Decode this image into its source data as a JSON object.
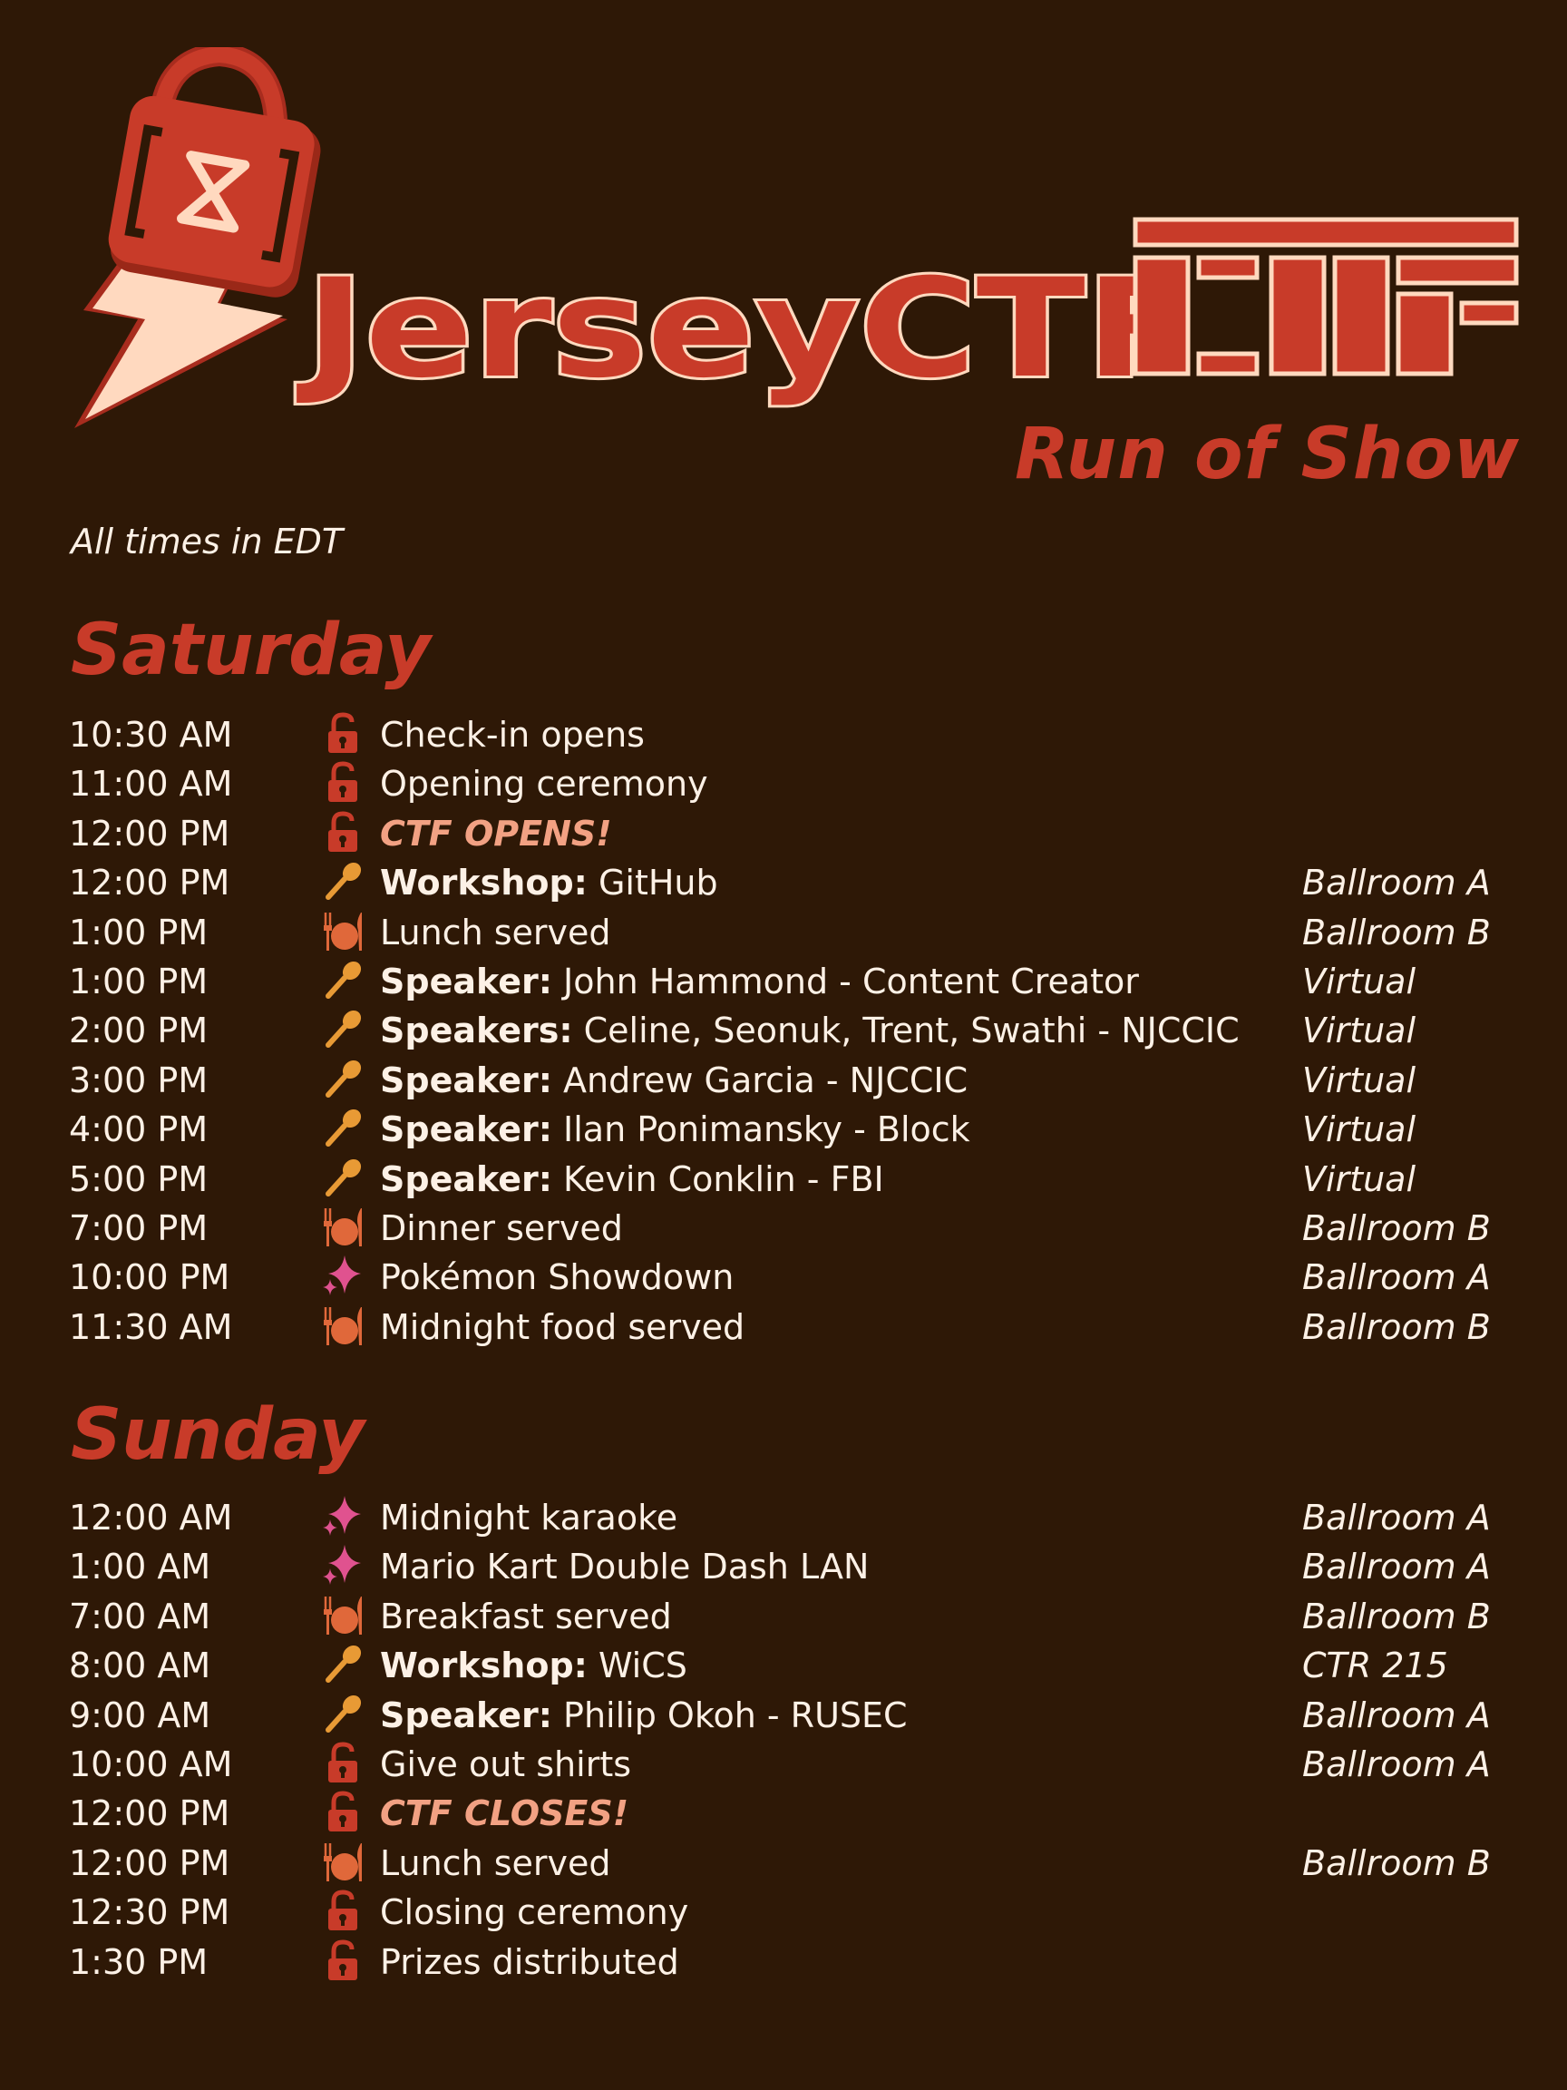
{
  "header": {
    "logo_text": "JerseyCTF",
    "subtitle": "Run of Show",
    "timezone_note": "All times in EDT"
  },
  "colors": {
    "background": "#2e1806",
    "accent_red": "#c83b29",
    "cream": "#ffd9bf",
    "highlight": "#f2a183",
    "mic_orange": "#e89a35",
    "food_orange": "#e0683a",
    "sparkle_pink": "#e0528f"
  },
  "days": [
    {
      "name": "Saturday",
      "events": [
        {
          "time": "10:30 AM",
          "icon": "lock-icon",
          "prefix": "",
          "text": "Check-in opens",
          "location": ""
        },
        {
          "time": "11:00 AM",
          "icon": "lock-icon",
          "prefix": "",
          "text": "Opening ceremony",
          "location": ""
        },
        {
          "time": "12:00 PM",
          "icon": "lock-icon",
          "prefix": "",
          "text": "CTF OPENS!",
          "location": "",
          "highlight": true
        },
        {
          "time": "12:00 PM",
          "icon": "microphone-icon",
          "prefix": "Workshop:",
          "text": " GitHub",
          "location": "Ballroom A"
        },
        {
          "time": "1:00 PM",
          "icon": "meal-icon",
          "prefix": "",
          "text": "Lunch served",
          "location": "Ballroom B"
        },
        {
          "time": "1:00 PM",
          "icon": "microphone-icon",
          "prefix": "Speaker:",
          "text": " John Hammond - Content Creator",
          "location": "Virtual"
        },
        {
          "time": "2:00 PM",
          "icon": "microphone-icon",
          "prefix": "Speakers:",
          "text": " Celine, Seonuk, Trent, Swathi - NJCCIC",
          "location": "Virtual"
        },
        {
          "time": "3:00 PM",
          "icon": "microphone-icon",
          "prefix": "Speaker:",
          "text": " Andrew Garcia - NJCCIC",
          "location": "Virtual"
        },
        {
          "time": "4:00 PM",
          "icon": "microphone-icon",
          "prefix": "Speaker:",
          "text": " Ilan Ponimansky - Block",
          "location": "Virtual"
        },
        {
          "time": "5:00 PM",
          "icon": "microphone-icon",
          "prefix": "Speaker:",
          "text": " Kevin Conklin - FBI",
          "location": "Virtual"
        },
        {
          "time": "7:00 PM",
          "icon": "meal-icon",
          "prefix": "",
          "text": "Dinner served",
          "location": "Ballroom B"
        },
        {
          "time": "10:00 PM",
          "icon": "sparkle-icon",
          "prefix": "",
          "text": "Pokémon Showdown",
          "location": "Ballroom A"
        },
        {
          "time": "11:30 AM",
          "icon": "meal-icon",
          "prefix": "",
          "text": "Midnight food served",
          "location": "Ballroom B"
        }
      ]
    },
    {
      "name": "Sunday",
      "events": [
        {
          "time": "12:00 AM",
          "icon": "sparkle-icon",
          "prefix": "",
          "text": "Midnight karaoke",
          "location": "Ballroom A"
        },
        {
          "time": "1:00 AM",
          "icon": "sparkle-icon",
          "prefix": "",
          "text": "Mario Kart Double Dash LAN",
          "location": "Ballroom A"
        },
        {
          "time": "7:00 AM",
          "icon": "meal-icon",
          "prefix": "",
          "text": "Breakfast served",
          "location": "Ballroom B"
        },
        {
          "time": "8:00 AM",
          "icon": "microphone-icon",
          "prefix": "Workshop:",
          "text": " WiCS",
          "location": "CTR 215"
        },
        {
          "time": "9:00 AM",
          "icon": "microphone-icon",
          "prefix": "Speaker:",
          "text": " Philip Okoh - RUSEC",
          "location": "Ballroom A"
        },
        {
          "time": "10:00 AM",
          "icon": "lock-icon",
          "prefix": "",
          "text": "Give out shirts",
          "location": "Ballroom A"
        },
        {
          "time": "12:00 PM",
          "icon": "lock-icon",
          "prefix": "",
          "text": "CTF CLOSES!",
          "location": "",
          "highlight": true
        },
        {
          "time": "12:00 PM",
          "icon": "meal-icon",
          "prefix": "",
          "text": "Lunch served",
          "location": "Ballroom B"
        },
        {
          "time": "12:30 PM",
          "icon": "lock-icon",
          "prefix": "",
          "text": "Closing ceremony",
          "location": ""
        },
        {
          "time": "1:30 PM",
          "icon": "lock-icon",
          "prefix": "",
          "text": "Prizes distributed",
          "location": ""
        }
      ]
    }
  ]
}
